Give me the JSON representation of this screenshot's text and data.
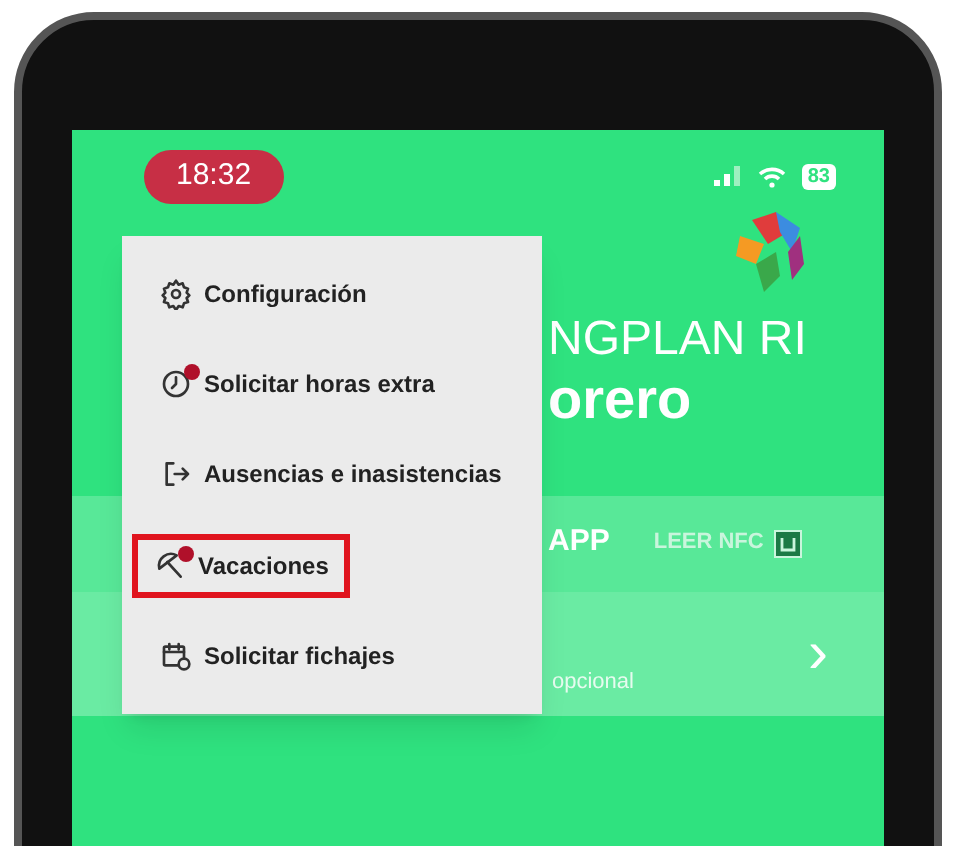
{
  "status_bar": {
    "time": "18:32",
    "battery": "83"
  },
  "header": {
    "line_1": "NGPLAN RI",
    "line_2": "orero"
  },
  "tabs": [
    {
      "label": "APP",
      "selected": true,
      "kind": "text"
    },
    {
      "label": "LEER NFC",
      "selected": false,
      "kind": "nfc"
    }
  ],
  "entry": {
    "hint": "opcional",
    "chevron": "›"
  },
  "menu": {
    "items": [
      {
        "label": "Configuración",
        "kind": "gear",
        "badge": false,
        "highlighted": false
      },
      {
        "label": "Solicitar horas extra",
        "kind": "clock",
        "badge": true,
        "highlighted": false
      },
      {
        "label": "Ausencias e inasistencias",
        "kind": "exit",
        "badge": false,
        "highlighted": false
      },
      {
        "label": "Vacaciones",
        "kind": "umbrella",
        "badge": true,
        "highlighted": true
      },
      {
        "label": "Solicitar fichajes",
        "kind": "calendar",
        "badge": false,
        "highlighted": false
      }
    ]
  }
}
